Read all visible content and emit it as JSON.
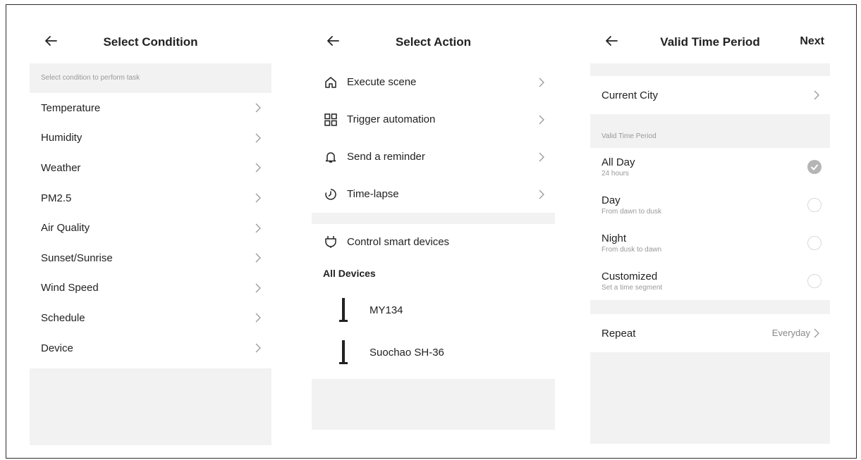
{
  "panel1": {
    "title": "Select Condition",
    "hint": "Select condition to perform task",
    "items": [
      {
        "label": "Temperature"
      },
      {
        "label": "Humidity"
      },
      {
        "label": "Weather"
      },
      {
        "label": "PM2.5"
      },
      {
        "label": "Air Quality"
      },
      {
        "label": "Sunset/Sunrise"
      },
      {
        "label": "Wind Speed"
      },
      {
        "label": "Schedule"
      },
      {
        "label": "Device"
      }
    ]
  },
  "panel2": {
    "title": "Select Action",
    "actions": [
      {
        "label": "Execute scene",
        "icon": "home-icon"
      },
      {
        "label": "Trigger automation",
        "icon": "grid-icon"
      },
      {
        "label": "Send a reminder",
        "icon": "bell-icon"
      },
      {
        "label": "Time-lapse",
        "icon": "timer-icon"
      }
    ],
    "control": {
      "label": "Control smart devices",
      "icon": "plug-icon"
    },
    "devices_heading": "All Devices",
    "devices": [
      {
        "label": "MY134"
      },
      {
        "label": "Suochao SH-36"
      }
    ]
  },
  "panel3": {
    "title": "Valid Time Period",
    "next_label": "Next",
    "city_label": "Current City",
    "section_label": "Valid Time Period",
    "options": [
      {
        "label": "All Day",
        "sub": "24 hours",
        "selected": true
      },
      {
        "label": "Day",
        "sub": "From dawn to dusk",
        "selected": false
      },
      {
        "label": "Night",
        "sub": "From dusk to dawn",
        "selected": false
      },
      {
        "label": "Customized",
        "sub": "Set a time segment",
        "selected": false
      }
    ],
    "repeat_label": "Repeat",
    "repeat_value": "Everyday"
  },
  "colors": {
    "panel_gray": "#f2f2f2",
    "text": "#222222",
    "hint": "#999999"
  }
}
